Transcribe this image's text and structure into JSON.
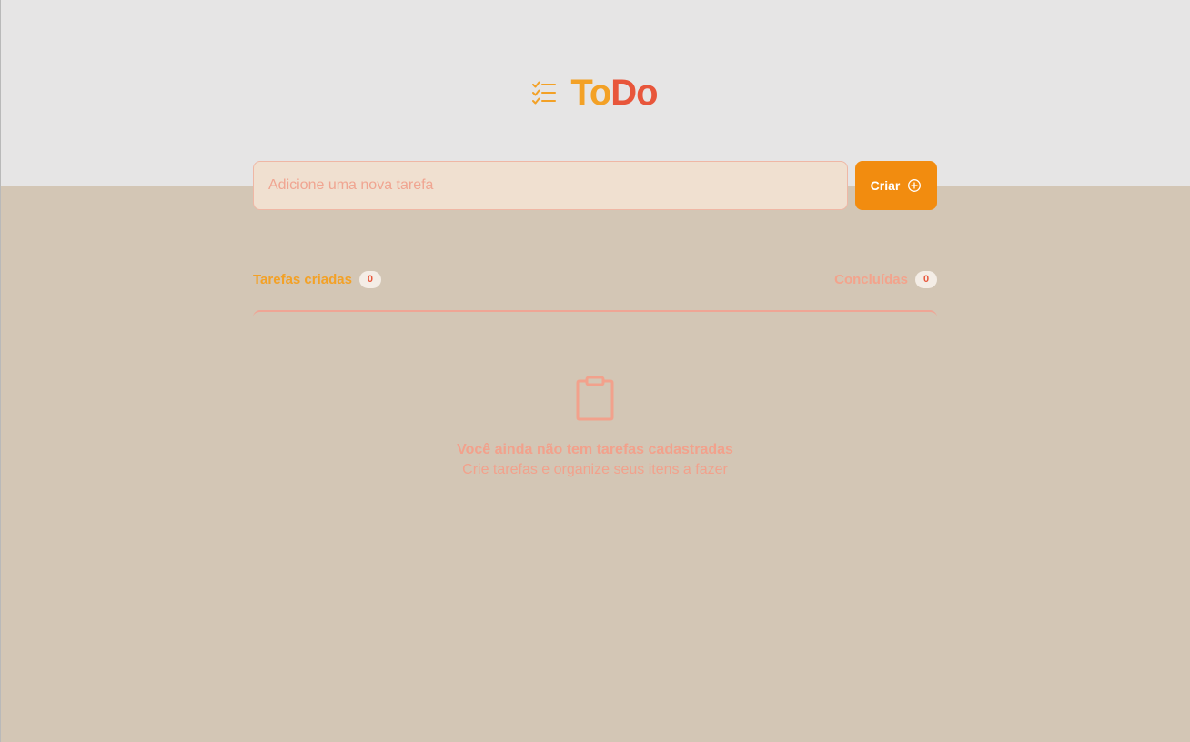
{
  "header": {
    "logo_icon": "checklist-icon",
    "logo_part1": "To",
    "logo_part2": "Do"
  },
  "new_task": {
    "placeholder": "Adicione uma nova tarefa",
    "value": "",
    "button_label": "Criar",
    "button_icon": "plus-circle-icon"
  },
  "counters": {
    "created_label": "Tarefas criadas",
    "created_count": "0",
    "done_label": "Concluídas",
    "done_count": "0"
  },
  "empty_state": {
    "icon": "clipboard-icon",
    "title": "Você ainda não tem tarefas cadastradas",
    "subtitle": "Crie tarefas e organize seus itens a fazer"
  },
  "colors": {
    "header_background": "#e6e5e5",
    "page_background": "#d3c6b5",
    "brand_orange": "#f3a126",
    "brand_red": "#e8563b",
    "button_orange": "#f28c0f",
    "input_background": "#f0e0d0",
    "muted_salmon": "#f2a18c"
  }
}
